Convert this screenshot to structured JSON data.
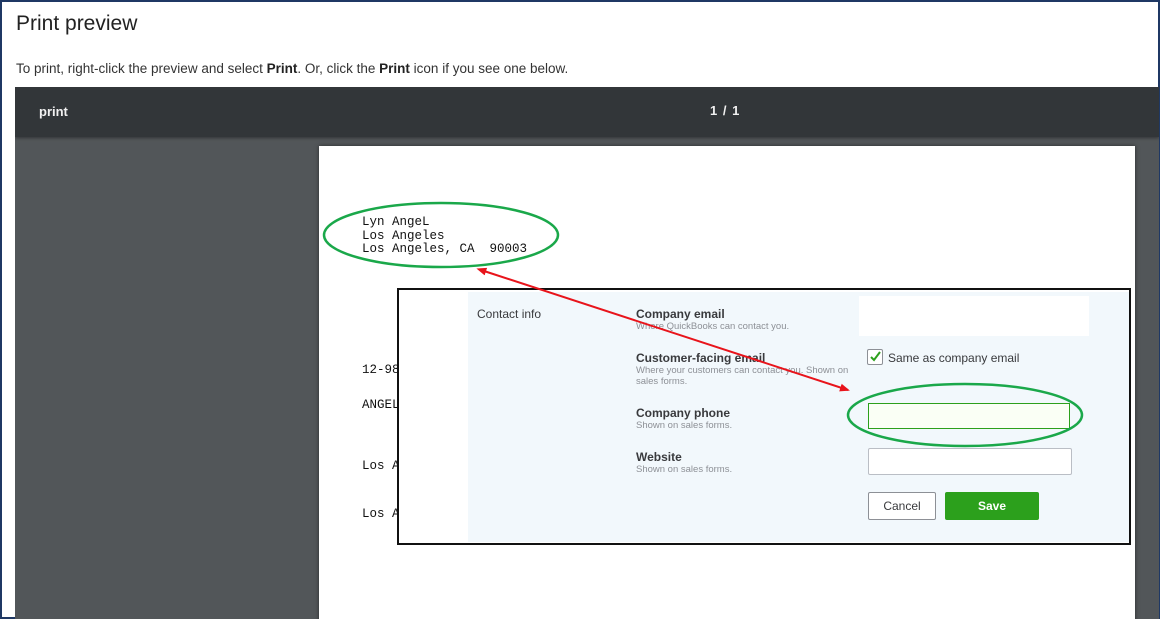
{
  "dialog": {
    "title": "Print preview",
    "instructions": {
      "part1": "To print, right-click the preview and select ",
      "bold1": "Print",
      "part2": ". Or, click the ",
      "bold2": "Print",
      "part3": " icon if you see one below."
    }
  },
  "viewer": {
    "print_label": "print",
    "page_indicator": "1 / 1"
  },
  "document": {
    "address_lines": [
      "Lyn AngeL",
      "Los Angeles",
      "Los Angeles, CA  90003"
    ],
    "line_a": "12-98",
    "line_b": "ANGEL",
    "line_c": "Los A",
    "line_d": "Los A"
  },
  "settings_panel": {
    "section_label": "Contact info",
    "company_email": {
      "label": "Company email",
      "hint": "Where QuickBooks can contact you.",
      "value": ""
    },
    "customer_facing_email": {
      "label": "Customer-facing email",
      "hint": "Where your customers can contact you. Shown on sales forms.",
      "checkbox_label": "Same as company email",
      "checked": true
    },
    "company_phone": {
      "label": "Company phone",
      "hint": "Shown on sales forms.",
      "value": ""
    },
    "website": {
      "label": "Website",
      "hint": "Shown on sales forms.",
      "value": ""
    },
    "cancel_label": "Cancel",
    "save_label": "Save"
  },
  "colors": {
    "frame_border": "#1f3864",
    "viewer_bg": "#525659",
    "toolbar_bg": "#323639",
    "save_green": "#2ca01c",
    "annotation_green": "#1aa84a",
    "annotation_red": "#e8141b"
  }
}
